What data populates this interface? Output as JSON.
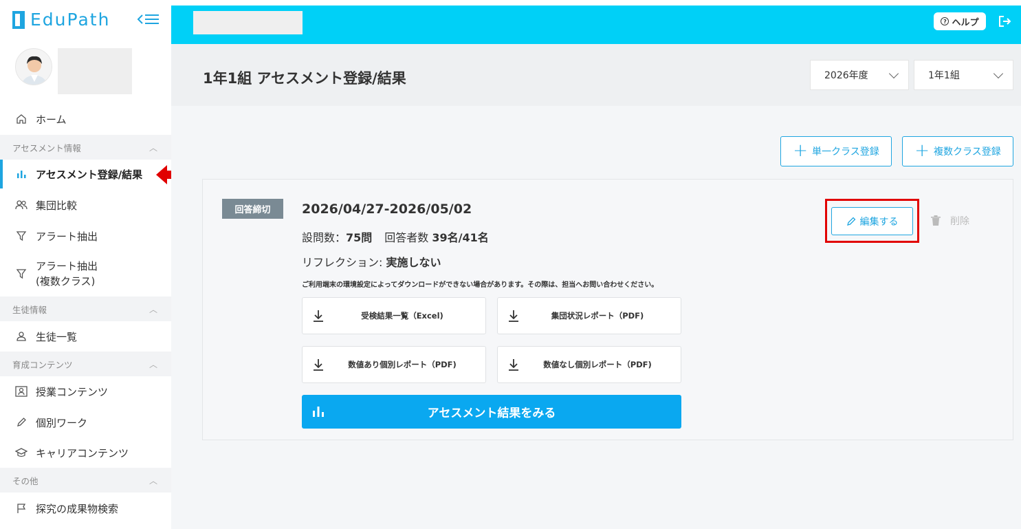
{
  "app": {
    "logo_text": "EduPath"
  },
  "sidebar": {
    "home": "ホーム",
    "sections": [
      {
        "label": "アセスメント情報",
        "items": [
          "アセスメント登録/結果",
          "集団比較",
          "アラート抽出"
        ],
        "multi_item_line1": "アラート抽出",
        "multi_item_line2": "(複数クラス)"
      },
      {
        "label": "生徒情報",
        "items": [
          "生徒一覧"
        ]
      },
      {
        "label": "育成コンテンツ",
        "items": [
          "授業コンテンツ",
          "個別ワーク",
          "キャリアコンテンツ"
        ]
      },
      {
        "label": "その他",
        "items": [
          "探究の成果物検索"
        ]
      }
    ]
  },
  "header": {
    "help_label": "ヘルプ",
    "help_icon_glyph": "?"
  },
  "page": {
    "title": "1年1組 アセスメント登録/結果",
    "year_select": "2026年度",
    "class_select": "1年1組",
    "single_register": "単一クラス登録",
    "multi_register": "複数クラス登録"
  },
  "card": {
    "status_badge": "回答締切",
    "period": "2026/04/27-2026/05/02",
    "questions_label": "設問数：",
    "questions_value": "75問",
    "respondents_label": "回答者数 ",
    "respondents_value": "39名/41名",
    "reflection_label": "リフレクション: ",
    "reflection_value": "実施しない",
    "notice": "ご利用端末の環境設定によってダウンロードができない場合があります。その際は、担当へお問い合わせください。",
    "downloads": [
      "受検結果一覧（Excel)",
      "集団状況レポート（PDF)",
      "数値あり個別レポート（PDF)",
      "数値なし個別レポート（PDF)"
    ],
    "result_button": "アセスメント結果をみる",
    "edit_button": "編集する",
    "delete_button": "削除"
  },
  "colors": {
    "accent": "#1ea5e0",
    "topbar": "#00d0f7",
    "primary_button": "#0aa8f0",
    "highlight": "#e10000",
    "badge": "#7a8a94"
  }
}
